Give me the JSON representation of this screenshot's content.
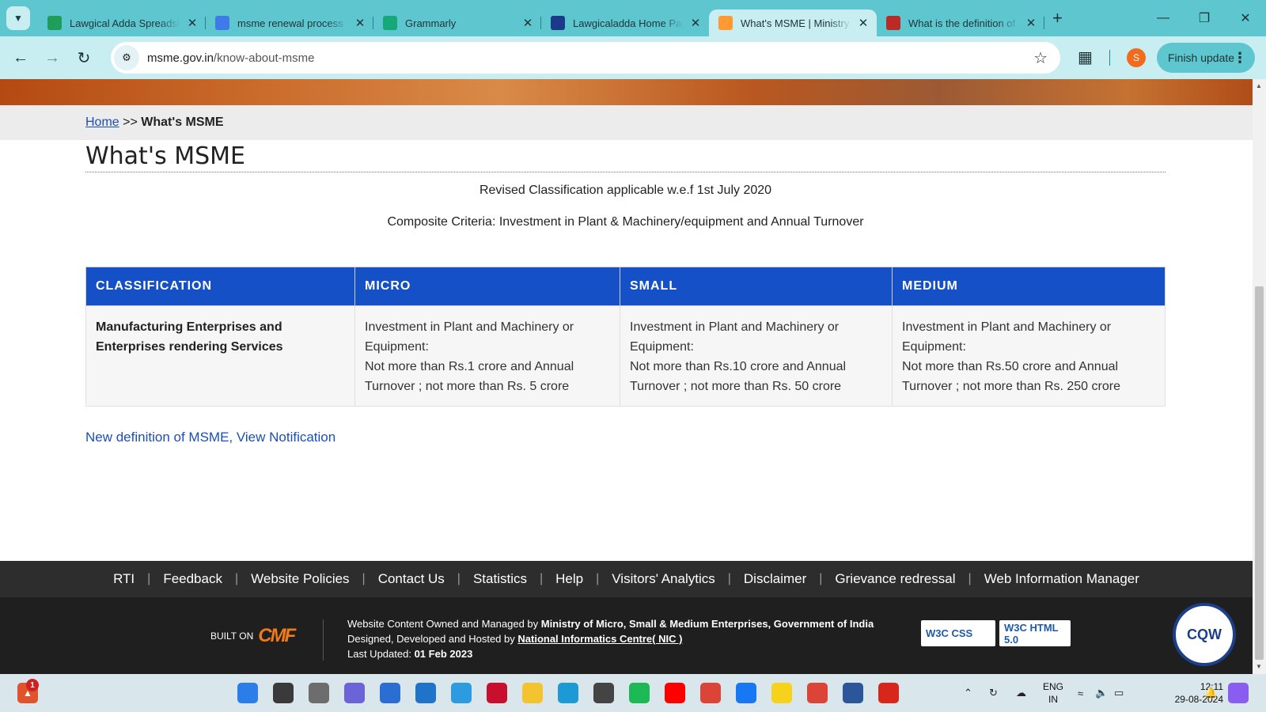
{
  "browser": {
    "tabs": [
      {
        "title": "Lawgical Adda Spreadsheet",
        "icon": "sheets-icon",
        "color": "#1e9e5a"
      },
      {
        "title": "msme renewal process",
        "icon": "docs-icon",
        "color": "#3f7be8"
      },
      {
        "title": "Grammarly",
        "icon": "grammarly-icon",
        "color": "#15a97a"
      },
      {
        "title": "Lawgicaladda Home Page",
        "icon": "lawgical-icon",
        "color": "#1c3a8a"
      },
      {
        "title": "What's MSME | Ministry",
        "icon": "india-flag-icon",
        "color": "#ff9933"
      },
      {
        "title": "What is the definition of",
        "icon": "quora-icon",
        "color": "#b92b27"
      }
    ],
    "active_tab": 4,
    "url_host": "msme.gov.in",
    "url_path": "/know-about-msme",
    "profile_initial": "S",
    "finish_update": "Finish update"
  },
  "page": {
    "breadcrumb_home": "Home",
    "breadcrumb_sep": ">>",
    "breadcrumb_current": "What's MSME",
    "title": "What's MSME",
    "subtitle1": "Revised Classification applicable w.e.f 1st July 2020",
    "subtitle2": "Composite Criteria: Investment in Plant & Machinery/equipment and Annual Turnover",
    "table": {
      "headers": [
        "CLASSIFICATION",
        "MICRO",
        "SMALL",
        "MEDIUM"
      ],
      "row_label": "Manufacturing Enterprises and Enterprises rendering Services",
      "cells": [
        {
          "line1": "Investment in Plant and Machinery or Equipment:",
          "line2": "Not more than Rs.1 crore and Annual Turnover ; not more than Rs. 5 crore"
        },
        {
          "line1": "Investment in Plant and Machinery or Equipment:",
          "line2": "Not more than Rs.10 crore and Annual Turnover ; not more than Rs. 50 crore"
        },
        {
          "line1": "Investment in Plant and Machinery or Equipment:",
          "line2": "Not more than Rs.50 crore and Annual Turnover ; not more than Rs. 250 crore"
        }
      ]
    },
    "notification_link": "New definition of MSME, View Notification"
  },
  "footer": {
    "links": [
      "RTI",
      "Feedback",
      "Website Policies",
      "Contact Us",
      "Statistics",
      "Help",
      "Visitors' Analytics",
      "Disclaimer",
      "Grievance redressal",
      "Web Information Manager"
    ],
    "built_on": "BUILT ON",
    "cmf": "CMF",
    "owned_prefix": "Website Content Owned and Managed by",
    "owned_by": "Ministry of Micro, Small & Medium Enterprises, Government of India",
    "hosted_prefix": "Designed, Developed and Hosted by",
    "hosted_by": "National Informatics Centre( NIC )",
    "updated_prefix": "Last Updated:",
    "updated_date": "01 Feb 2023",
    "w3c_css": "W3C CSS",
    "w3c_html": "W3C HTML 5.0",
    "cqw": "CQW"
  },
  "taskbar": {
    "notification_count": "1",
    "lang_line1": "ENG",
    "lang_line2": "IN",
    "time": "12:11",
    "date": "29-08-2024"
  }
}
